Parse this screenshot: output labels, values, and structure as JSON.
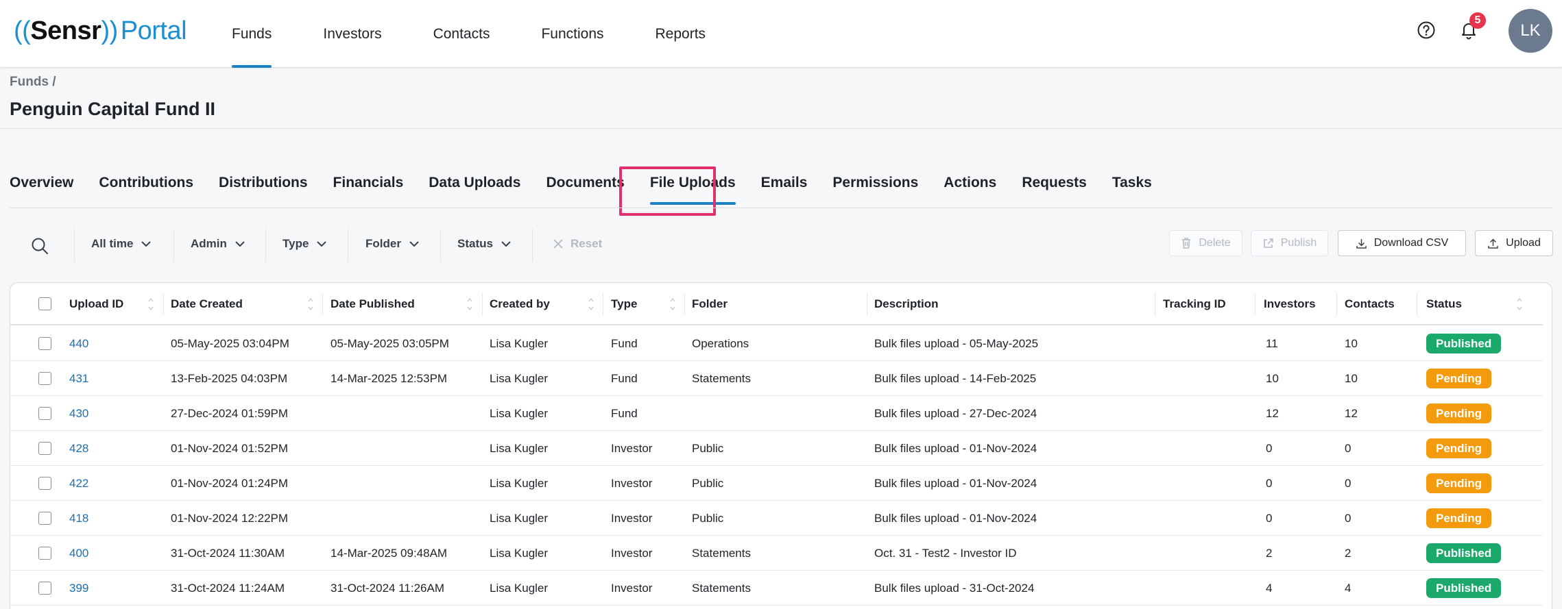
{
  "app": {
    "logo": {
      "wave": "((",
      "brand": "Sensr",
      "wave_close": "))",
      "portal": "Portal"
    },
    "nav": [
      {
        "label": "Funds",
        "active": true
      },
      {
        "label": "Investors"
      },
      {
        "label": "Contacts"
      },
      {
        "label": "Functions"
      },
      {
        "label": "Reports"
      }
    ],
    "notifications_count": "5",
    "avatar_initials": "LK",
    "icons": {
      "help": "help-circle-icon",
      "bell": "bell-icon"
    }
  },
  "header": {
    "breadcrumb": "Funds /",
    "title": "Penguin Capital Fund II"
  },
  "tabs": [
    {
      "label": "Overview"
    },
    {
      "label": "Contributions"
    },
    {
      "label": "Distributions"
    },
    {
      "label": "Financials"
    },
    {
      "label": "Data Uploads"
    },
    {
      "label": "Documents"
    },
    {
      "label": "File Uploads",
      "active": true
    },
    {
      "label": "Emails"
    },
    {
      "label": "Permissions"
    },
    {
      "label": "Actions"
    },
    {
      "label": "Requests"
    },
    {
      "label": "Tasks"
    }
  ],
  "filters": {
    "time": "All time",
    "admin": "Admin",
    "type": "Type",
    "folder": "Folder",
    "status": "Status",
    "reset": "Reset"
  },
  "actions": {
    "delete": "Delete",
    "publish": "Publish",
    "download_csv": "Download CSV",
    "upload": "Upload"
  },
  "table": {
    "columns": {
      "upload_id": "Upload ID",
      "date_created": "Date Created",
      "date_published": "Date Published",
      "created_by": "Created by",
      "type": "Type",
      "folder": "Folder",
      "description": "Description",
      "tracking_id": "Tracking ID",
      "investors": "Investors",
      "contacts": "Contacts",
      "status": "Status"
    },
    "rows": [
      {
        "id": "440",
        "created": "05-May-2025 03:04PM",
        "published": "05-May-2025 03:05PM",
        "by": "Lisa Kugler",
        "type": "Fund",
        "folder": "Operations",
        "description": "Bulk files upload - 05-May-2025",
        "tracking": "",
        "investors": "11",
        "contacts": "10",
        "status": "Published"
      },
      {
        "id": "431",
        "created": "13-Feb-2025 04:03PM",
        "published": "14-Mar-2025 12:53PM",
        "by": "Lisa Kugler",
        "type": "Fund",
        "folder": "Statements",
        "description": "Bulk files upload - 14-Feb-2025",
        "tracking": "",
        "investors": "10",
        "contacts": "10",
        "status": "Pending"
      },
      {
        "id": "430",
        "created": "27-Dec-2024 01:59PM",
        "published": "",
        "by": "Lisa Kugler",
        "type": "Fund",
        "folder": "",
        "description": "Bulk files upload - 27-Dec-2024",
        "tracking": "",
        "investors": "12",
        "contacts": "12",
        "status": "Pending"
      },
      {
        "id": "428",
        "created": "01-Nov-2024 01:52PM",
        "published": "",
        "by": "Lisa Kugler",
        "type": "Investor",
        "folder": "Public",
        "description": "Bulk files upload - 01-Nov-2024",
        "tracking": "",
        "investors": "0",
        "contacts": "0",
        "status": "Pending"
      },
      {
        "id": "422",
        "created": "01-Nov-2024 01:24PM",
        "published": "",
        "by": "Lisa Kugler",
        "type": "Investor",
        "folder": "Public",
        "description": "Bulk files upload - 01-Nov-2024",
        "tracking": "",
        "investors": "0",
        "contacts": "0",
        "status": "Pending"
      },
      {
        "id": "418",
        "created": "01-Nov-2024 12:22PM",
        "published": "",
        "by": "Lisa Kugler",
        "type": "Investor",
        "folder": "Public",
        "description": "Bulk files upload - 01-Nov-2024",
        "tracking": "",
        "investors": "0",
        "contacts": "0",
        "status": "Pending"
      },
      {
        "id": "400",
        "created": "31-Oct-2024 11:30AM",
        "published": "14-Mar-2025 09:48AM",
        "by": "Lisa Kugler",
        "type": "Investor",
        "folder": "Statements",
        "description": "Oct. 31 - Test2 - Investor ID",
        "tracking": "",
        "investors": "2",
        "contacts": "2",
        "status": "Published"
      },
      {
        "id": "399",
        "created": "31-Oct-2024 11:24AM",
        "published": "31-Oct-2024 11:26AM",
        "by": "Lisa Kugler",
        "type": "Investor",
        "folder": "Statements",
        "description": "Bulk files upload - 31-Oct-2024",
        "tracking": "",
        "investors": "4",
        "contacts": "4",
        "status": "Published"
      }
    ]
  },
  "colors": {
    "accent": "#1b7fc4",
    "link": "#1b6fb0",
    "published": "#1aa96b",
    "pending": "#f39a0d",
    "badge": "#e8334a",
    "highlight": "#e0316b"
  }
}
